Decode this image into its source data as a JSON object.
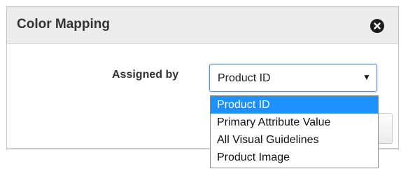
{
  "dialog": {
    "title": "Color Mapping",
    "close_icon": "close-icon"
  },
  "form": {
    "assigned_by_label": "Assigned by",
    "assigned_by_value": "Product ID"
  },
  "dropdown": {
    "options": [
      {
        "label": "Product ID",
        "selected": true
      },
      {
        "label": "Primary Attribute Value",
        "selected": false
      },
      {
        "label": "All Visual Guidelines",
        "selected": false
      },
      {
        "label": "Product Image",
        "selected": false
      }
    ]
  },
  "colors": {
    "highlight": "#1e90ff",
    "titlebar_bg": "#ececec",
    "title_text": "#333333"
  }
}
